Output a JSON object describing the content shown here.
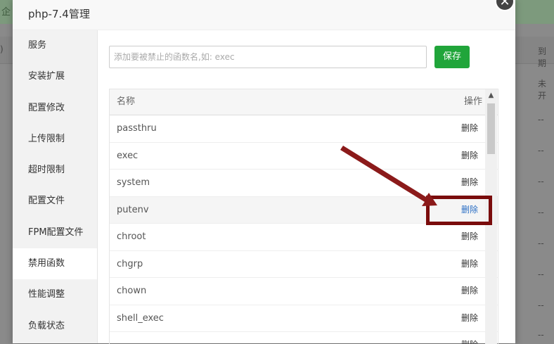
{
  "background": {
    "top_left_text": "企",
    "right_header": "到期",
    "right_first": "未开",
    "right_rows": [
      "--",
      "--",
      "--",
      "--",
      "--",
      "--",
      "--",
      "--"
    ]
  },
  "modal": {
    "title": "php-7.4管理",
    "close_icon": "close-icon"
  },
  "sidebar": {
    "items": [
      {
        "label": "服务"
      },
      {
        "label": "安装扩展"
      },
      {
        "label": "配置修改"
      },
      {
        "label": "上传限制"
      },
      {
        "label": "超时限制"
      },
      {
        "label": "配置文件"
      },
      {
        "label": "FPM配置文件"
      },
      {
        "label": "禁用函数",
        "active": true
      },
      {
        "label": "性能调整"
      },
      {
        "label": "负载状态"
      }
    ]
  },
  "toolbar": {
    "input_placeholder": "添加要被禁止的函数名,如: exec",
    "input_value": "",
    "save_label": "保存"
  },
  "table": {
    "headers": {
      "name": "名称",
      "action": "操作"
    },
    "rows": [
      {
        "name": "passthru",
        "action": "删除"
      },
      {
        "name": "exec",
        "action": "删除"
      },
      {
        "name": "system",
        "action": "删除"
      },
      {
        "name": "putenv",
        "action": "删除",
        "highlighted": true
      },
      {
        "name": "chroot",
        "action": "删除"
      },
      {
        "name": "chgrp",
        "action": "删除"
      },
      {
        "name": "chown",
        "action": "删除"
      },
      {
        "name": "shell_exec",
        "action": "删除"
      },
      {
        "name": "",
        "action": "删除"
      }
    ]
  },
  "colors": {
    "accent": "#20a53a",
    "highlight_box": "#7a0c0c",
    "arrow": "#8b1a1a"
  }
}
